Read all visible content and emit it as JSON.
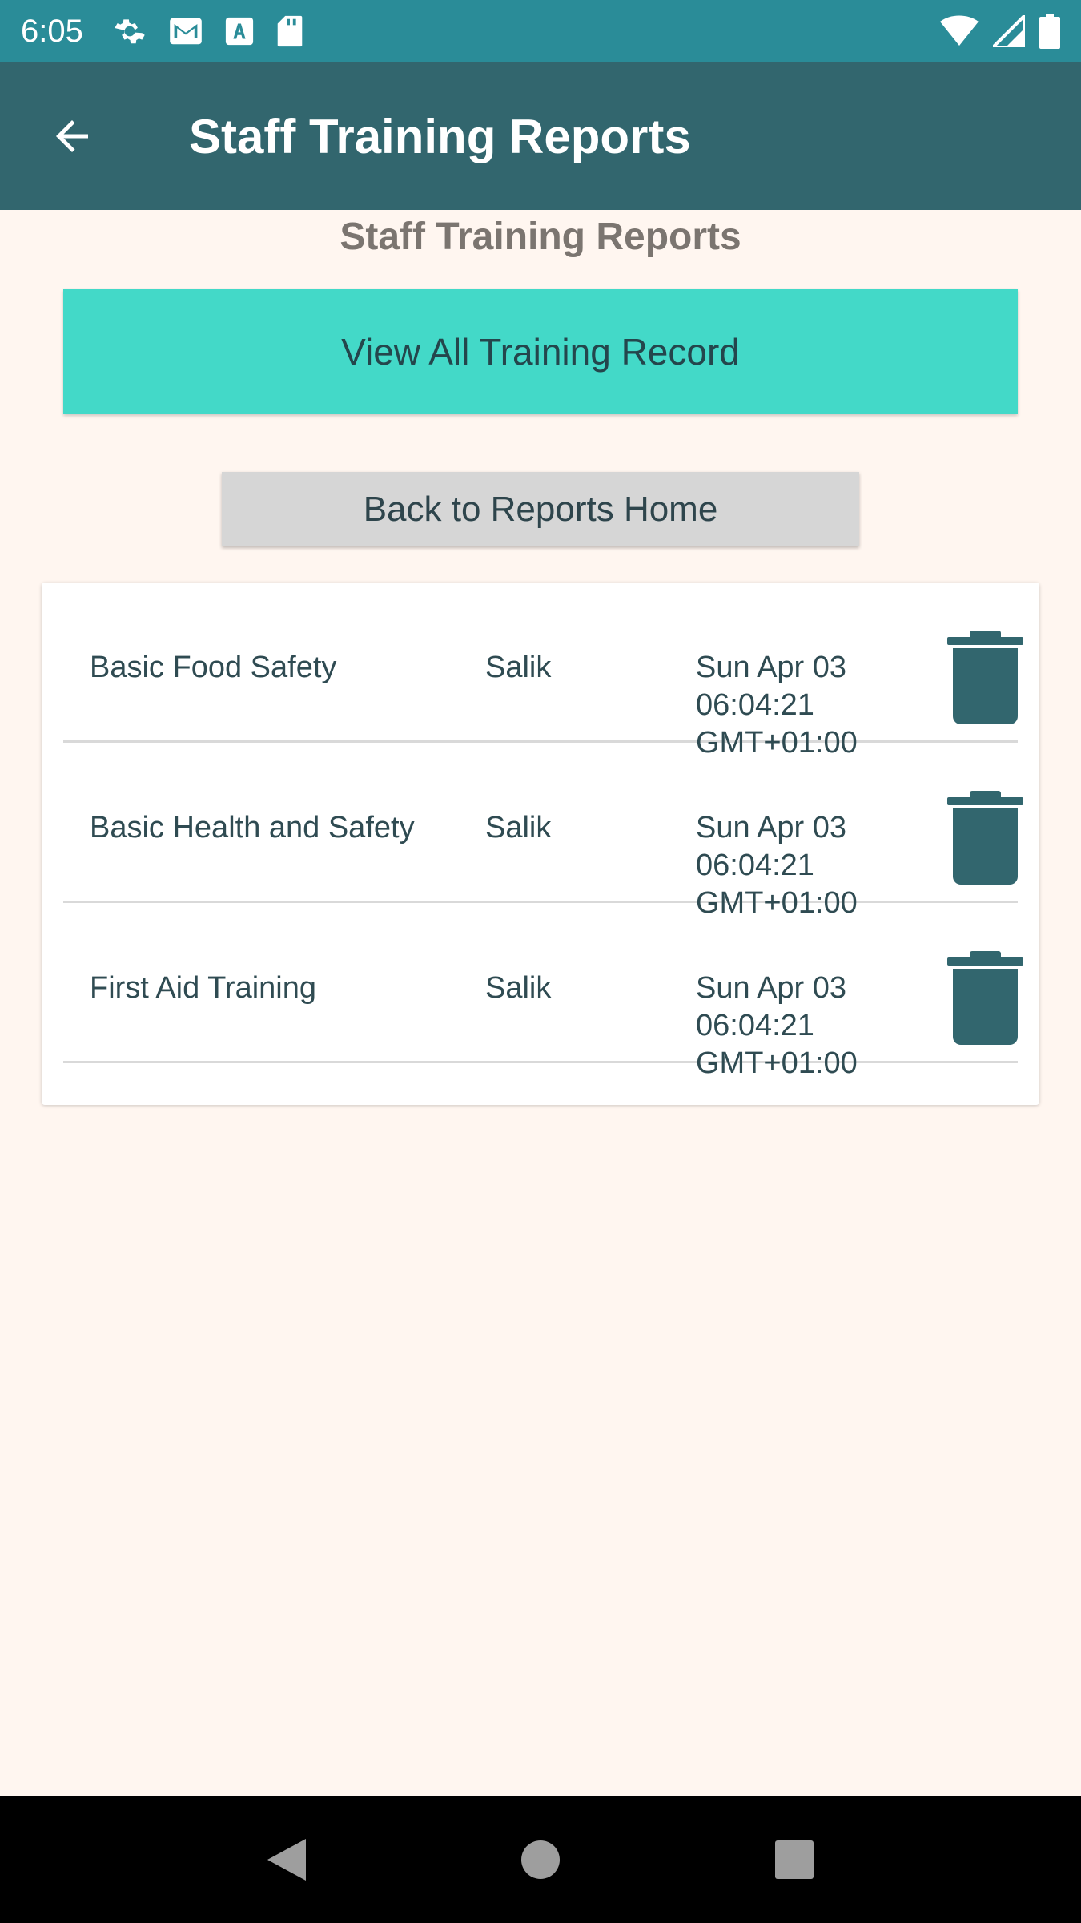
{
  "status_bar": {
    "time": "6:05",
    "left_icons": [
      "settings-icon",
      "gmail-icon",
      "a-icon",
      "sd-card-icon"
    ],
    "right_icons": [
      "wifi-icon",
      "signal-icon",
      "battery-icon"
    ]
  },
  "app_bar": {
    "title": "Staff Training Reports",
    "back_icon": "arrow-back-icon"
  },
  "page": {
    "heading": "Staff Training Reports",
    "view_all_label": "View All Training Record",
    "back_home_label": "Back to Reports Home"
  },
  "records": [
    {
      "course": "Basic Food Safety",
      "staff": "Salik",
      "date": "Sun Apr 03 06:04:21 GMT+01:00"
    },
    {
      "course": "Basic Health and Safety",
      "staff": "Salik",
      "date": "Sun Apr 03 06:04:21 GMT+01:00"
    },
    {
      "course": "First Aid Training",
      "staff": "Salik",
      "date": "Sun Apr 03 06:04:21 GMT+01:00"
    }
  ],
  "colors": {
    "status_bar": "#2a8c98",
    "app_bar": "#32666e",
    "accent": "#43d9c8",
    "background": "#fff6f0",
    "icon": "#32666e"
  },
  "nav_bar": {
    "icons": [
      "nav-back-icon",
      "nav-home-icon",
      "nav-recents-icon"
    ]
  }
}
